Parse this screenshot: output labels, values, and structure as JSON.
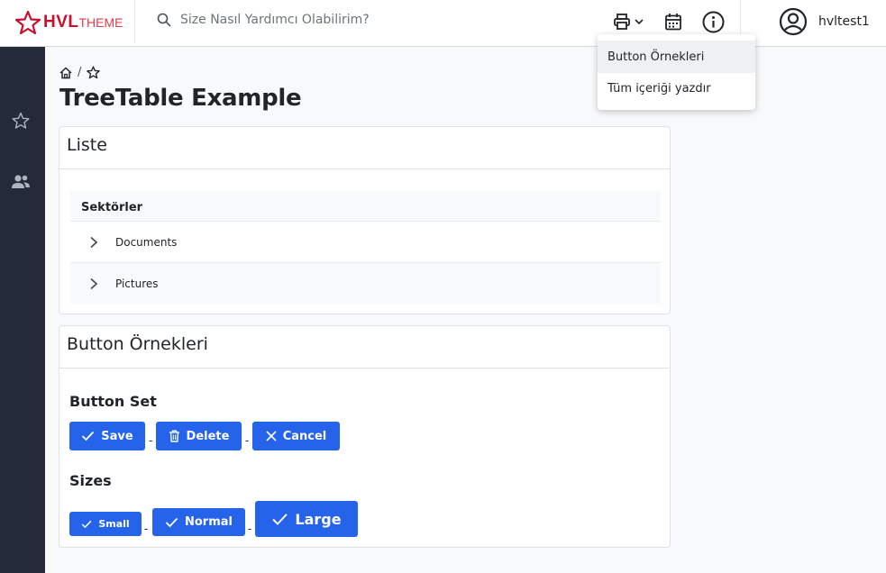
{
  "header": {
    "logo_text": "HVL",
    "logo_sub": "THEME",
    "search_placeholder": "Size Nasıl Yardımcı Olabilirim?",
    "username": "hvltest1"
  },
  "breadcrumb": {
    "separator": "/"
  },
  "page_title": "TreeTable Example",
  "liste_card": {
    "title": "Liste",
    "column_header": "Sektörler",
    "rows": [
      {
        "label": "Documents"
      },
      {
        "label": "Pictures"
      }
    ]
  },
  "buttons_card": {
    "title": "Button Örnekleri",
    "button_set_title": "Button Set",
    "button_set": {
      "save": "Save",
      "delete": "Delete",
      "cancel": "Cancel"
    },
    "sizes_title": "Sizes",
    "sizes": {
      "small": "Small",
      "normal": "Normal",
      "large": "Large"
    },
    "dash": "-"
  },
  "print_menu": {
    "items": [
      {
        "label": "Button Örnekleri"
      },
      {
        "label": "Tüm içeriği yazdır"
      }
    ]
  },
  "colors": {
    "primary": "#2563eb",
    "sidebar": "#232a39",
    "brand": "#c8102e"
  },
  "icons": [
    "search-icon",
    "printer-icon",
    "calendar-icon",
    "info-icon",
    "user-circle-icon",
    "star-icon",
    "users-icon",
    "home-icon",
    "chevron-right-icon",
    "check-icon",
    "trash-icon",
    "close-icon"
  ]
}
